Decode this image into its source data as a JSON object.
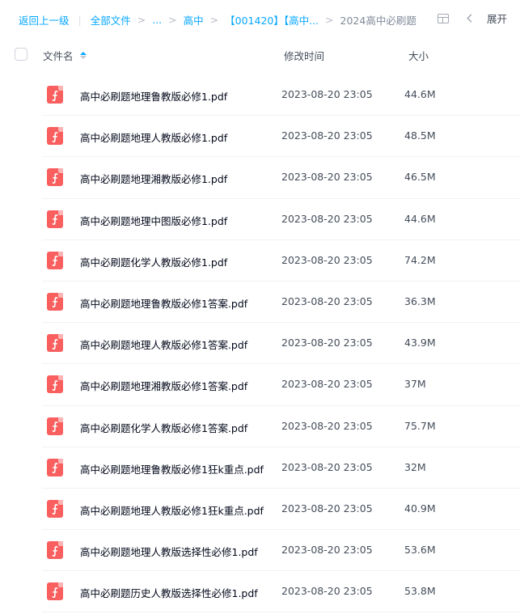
{
  "breadcrumb": {
    "back": "返回上一级",
    "all_files": "全部文件",
    "ellipsis": "...",
    "level1": "高中",
    "level2": "【001420】【高中...",
    "current": "2024高中必刷题"
  },
  "toolbar": {
    "expand_label": "展开"
  },
  "header": {
    "name_label": "文件名",
    "time_label": "修改时间",
    "size_label": "大小"
  },
  "files": [
    {
      "name": "高中必刷题地理鲁教版必修1.pdf",
      "time": "2023-08-20 23:05",
      "size": "44.6M"
    },
    {
      "name": "高中必刷题地理人教版必修1.pdf",
      "time": "2023-08-20 23:05",
      "size": "48.5M"
    },
    {
      "name": "高中必刷题地理湘教版必修1.pdf",
      "time": "2023-08-20 23:05",
      "size": "46.5M"
    },
    {
      "name": "高中必刷题地理中图版必修1.pdf",
      "time": "2023-08-20 23:05",
      "size": "44.6M"
    },
    {
      "name": "高中必刷题化学人教版必修1.pdf",
      "time": "2023-08-20 23:05",
      "size": "74.2M"
    },
    {
      "name": "高中必刷题地理鲁教版必修1答案.pdf",
      "time": "2023-08-20 23:05",
      "size": "36.3M"
    },
    {
      "name": "高中必刷题地理人教版必修1答案.pdf",
      "time": "2023-08-20 23:05",
      "size": "43.9M"
    },
    {
      "name": "高中必刷题地理湘教版必修1答案.pdf",
      "time": "2023-08-20 23:05",
      "size": "37M"
    },
    {
      "name": "高中必刷题化学人教版必修1答案.pdf",
      "time": "2023-08-20 23:05",
      "size": "75.7M"
    },
    {
      "name": "高中必刷题地理鲁教版必修1狂k重点.pdf",
      "time": "2023-08-20 23:05",
      "size": "32M"
    },
    {
      "name": "高中必刷题地理人教版必修1狂k重点.pdf",
      "time": "2023-08-20 23:05",
      "size": "40.9M"
    },
    {
      "name": "高中必刷题地理人教版选择性必修1.pdf",
      "time": "2023-08-20 23:05",
      "size": "53.6M"
    },
    {
      "name": "高中必刷题历史人教版选择性必修1.pdf",
      "time": "2023-08-20 23:05",
      "size": "53.8M"
    }
  ],
  "colors": {
    "accent": "#06a7ff",
    "pdf_icon": "#fa5f5f",
    "text_primary": "#03081a",
    "text_secondary": "#454d5a"
  }
}
